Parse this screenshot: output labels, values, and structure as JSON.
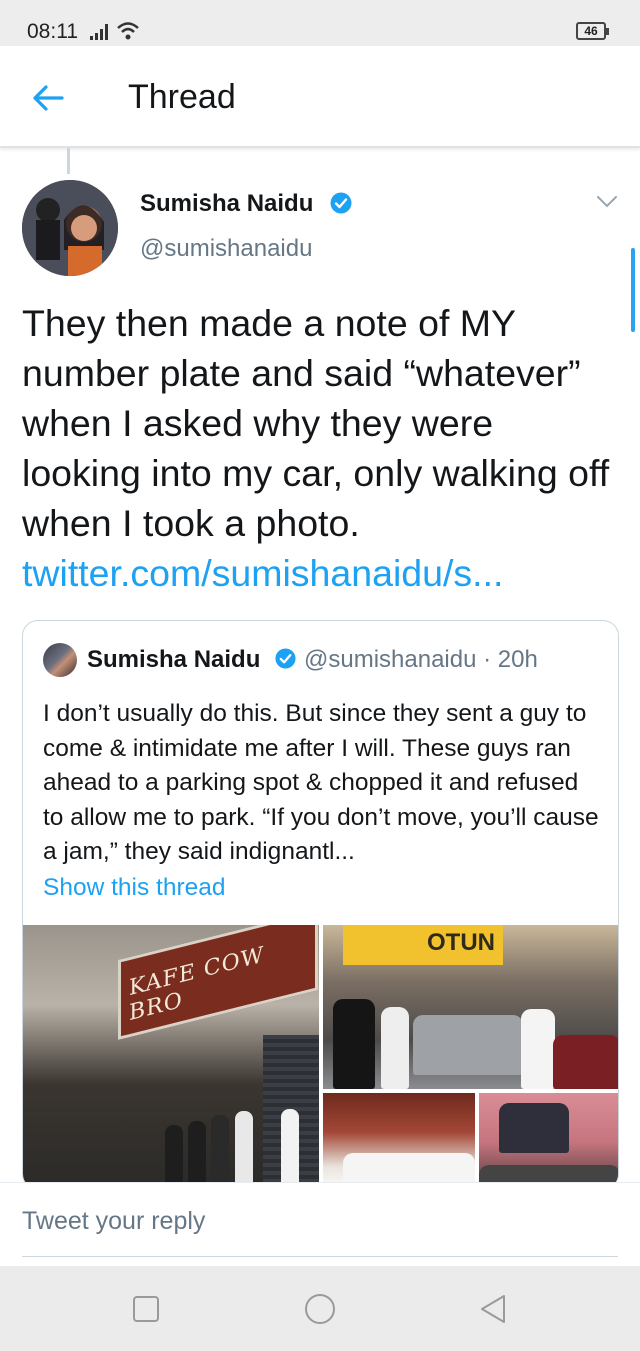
{
  "status_bar": {
    "time": "08:11",
    "battery": "46"
  },
  "header": {
    "title": "Thread"
  },
  "tweet": {
    "author_name": "Sumisha Naidu",
    "author_handle": "@sumishanaidu",
    "text": "They then made a note of MY number plate and said “whatever” when I asked why they were looking into my car, only walking off when I took a photo.",
    "link": "twitter.com/sumishanaidu/s..."
  },
  "quoted_tweet": {
    "author_name": "Sumisha Naidu",
    "meta": "@sumishanaidu · 20h",
    "text": "I don’t usually do this. But since they sent a guy to come & intimidate me after I will. These guys ran ahead to a parking spot & chopped it and refused to allow me to park. “If you don’t move, you’ll cause a jam,” they said indignantl...",
    "show_thread": "Show this thread",
    "photos": {
      "sign_text": "KAFE COW BRO",
      "shop_sign": "OTUN"
    }
  },
  "reply": {
    "placeholder": "Tweet your reply"
  },
  "colors": {
    "accent": "#1da1f2",
    "secondary_text": "#657786",
    "border": "#ccd6dd"
  },
  "icons": {
    "back": "arrow-left-icon",
    "verified": "verified-badge-icon",
    "more": "chevron-down-icon",
    "nav_recents": "square-icon",
    "nav_home": "circle-icon",
    "nav_back": "triangle-back-icon"
  }
}
